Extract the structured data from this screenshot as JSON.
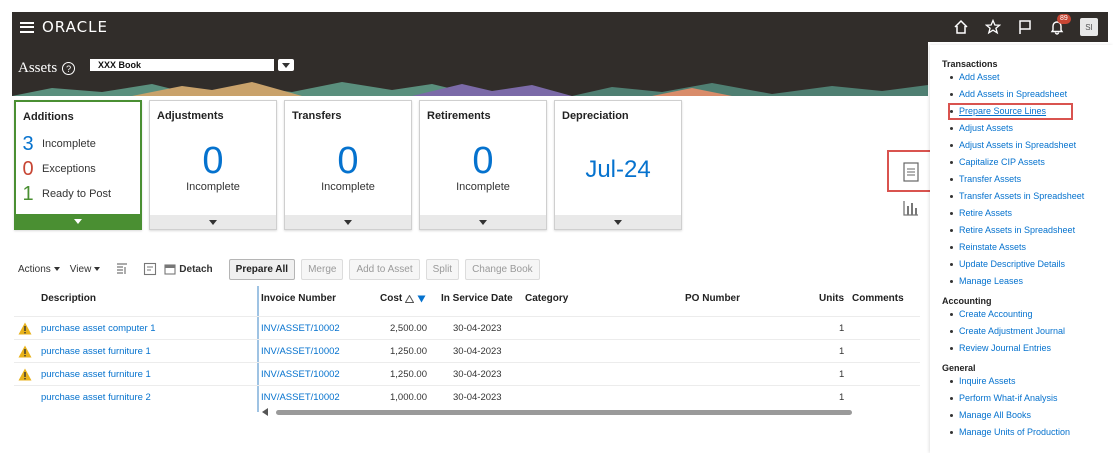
{
  "header": {
    "brand": "ORACLE",
    "notification_count": "89",
    "user_initials": "SI"
  },
  "page": {
    "title": "Assets",
    "help_glyph": "?",
    "book_value": "XXX Book"
  },
  "tiles": {
    "additions": {
      "title": "Additions",
      "rows": [
        {
          "count": "3",
          "label": "Incomplete",
          "color": "#0572ce"
        },
        {
          "count": "0",
          "label": "Exceptions",
          "color": "#c74634"
        },
        {
          "count": "1",
          "label": "Ready to Post",
          "color": "#4a8f32"
        }
      ]
    },
    "adjustments": {
      "title": "Adjustments",
      "value": "0",
      "sub": "Incomplete"
    },
    "transfers": {
      "title": "Transfers",
      "value": "0",
      "sub": "Incomplete"
    },
    "retirements": {
      "title": "Retirements",
      "value": "0",
      "sub": "Incomplete"
    },
    "depreciation": {
      "title": "Depreciation",
      "value": "Jul-24"
    }
  },
  "toolbar": {
    "actions": "Actions",
    "view": "View",
    "detach": "Detach",
    "prepare_all": "Prepare All",
    "merge": "Merge",
    "add_to_asset": "Add to Asset",
    "split": "Split",
    "change_book": "Change Book"
  },
  "table": {
    "headers": {
      "description": "Description",
      "invoice_number": "Invoice Number",
      "cost": "Cost",
      "in_service_date": "In Service Date",
      "category": "Category",
      "po_number": "PO Number",
      "units": "Units",
      "comments": "Comments"
    },
    "rows": [
      {
        "warning": true,
        "description": "purchase asset computer 1",
        "invoice": "INV/ASSET/10002",
        "cost": "2,500.00",
        "date": "30-04-2023",
        "units": "1"
      },
      {
        "warning": true,
        "description": "purchase asset furniture 1",
        "invoice": "INV/ASSET/10002",
        "cost": "1,250.00",
        "date": "30-04-2023",
        "units": "1"
      },
      {
        "warning": true,
        "description": "purchase asset furniture 1",
        "invoice": "INV/ASSET/10002",
        "cost": "1,250.00",
        "date": "30-04-2023",
        "units": "1"
      },
      {
        "warning": false,
        "description": "purchase asset furniture 2",
        "invoice": "INV/ASSET/10002",
        "cost": "1,000.00",
        "date": "30-04-2023",
        "units": "1"
      }
    ]
  },
  "panel": {
    "transactions": {
      "title": "Transactions",
      "items": [
        "Add Asset",
        "Add Assets in Spreadsheet",
        "Prepare Source Lines",
        "Adjust Assets",
        "Adjust Assets in Spreadsheet",
        "Capitalize CIP Assets",
        "Transfer Assets",
        "Transfer Assets in Spreadsheet",
        "Retire Assets",
        "Retire Assets in Spreadsheet",
        "Reinstate Assets",
        "Update Descriptive Details",
        "Manage Leases"
      ]
    },
    "accounting": {
      "title": "Accounting",
      "items": [
        "Create Accounting",
        "Create Adjustment Journal",
        "Review Journal Entries"
      ]
    },
    "general": {
      "title": "General",
      "items": [
        "Inquire Assets",
        "Perform What-if Analysis",
        "Manage All Books",
        "Manage Units of Production"
      ]
    }
  },
  "colors": {
    "topbar": "#312d2a",
    "link": "#0572ce",
    "selected_tile": "#4a8f32",
    "highlight": "#d9534f"
  }
}
